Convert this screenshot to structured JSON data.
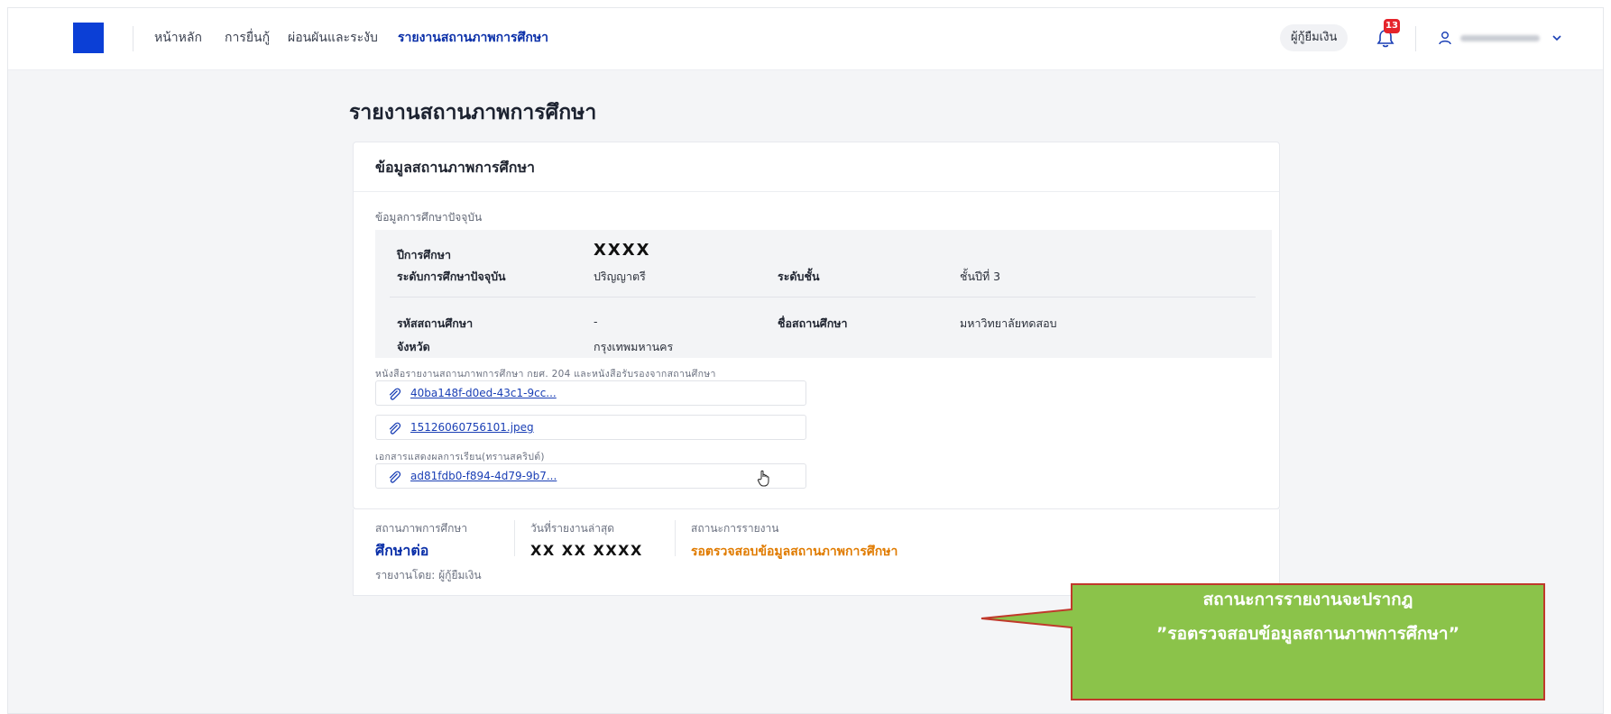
{
  "nav": {
    "links": [
      "หน้าหลัก",
      "การยื่นกู้",
      "ผ่อนผันและระงับ",
      "รายงานสถานภาพการศึกษา"
    ],
    "active_index": 3,
    "role": "ผู้กู้ยืมเงิน",
    "notification_count": "13",
    "user_name": "",
    "brand_color": "#0b3fd6"
  },
  "page": {
    "title": "รายงานสถานภาพการศึกษา"
  },
  "card": {
    "title": "ข้อมูลสถานภาพการศึกษา",
    "section_label": "ข้อมูลการศึกษาปัจจุบัน",
    "fields": {
      "academic_year_label": "ปีการศึกษา",
      "academic_year_value": "XXXX",
      "edu_level_label": "ระดับการศึกษาปัจจุบัน",
      "edu_level_value": "ปริญญาตรี",
      "class_level_label": "ระดับชั้น",
      "class_level_value": "ชั้นปีที่ 3",
      "school_code_label": "รหัสสถานศึกษา",
      "school_code_value": "-",
      "school_name_label": "ชื่อสถานศึกษา",
      "school_name_value": "มหาวิทยาลัยทดสอบ",
      "province_label": "จังหวัด",
      "province_value": "กรุงเทพมหานคร"
    },
    "documents": [
      {
        "label": "หนังสือรายงานสถานภาพการศึกษา กยศ. 204 และหนังสือรับรองจากสถานศึกษา",
        "files": [
          "40ba148f-d0ed-43c1-9cc...",
          "15126060756101.jpeg"
        ]
      },
      {
        "label": "เอกสารแสดงผลการเรียน(ทรานสคริปต์)",
        "files": [
          "ad81fdb0-f894-4d79-9b7..."
        ]
      }
    ]
  },
  "status": {
    "edu_status_label": "สถานภาพการศึกษา",
    "edu_status_value": "ศึกษาต่อ",
    "last_report_label": "วันที่รายงานล่าสุด",
    "last_report_value": "XX XX XXXX",
    "report_status_label": "สถานะการรายงาน",
    "report_status_value": "รอตรวจสอบข้อมูลสถานภาพการศึกษา",
    "reported_by": "รายงานโดย: ผู้กู้ยืมเงิน",
    "status_color": "#e07b00"
  },
  "callout": {
    "line1": "สถานะการรายงานจะปรากฎ",
    "line2": "”รอตรวจสอบข้อมูลสถานภาพการศึกษา”",
    "fill": "#8bc34a",
    "border": "#c0392b"
  }
}
